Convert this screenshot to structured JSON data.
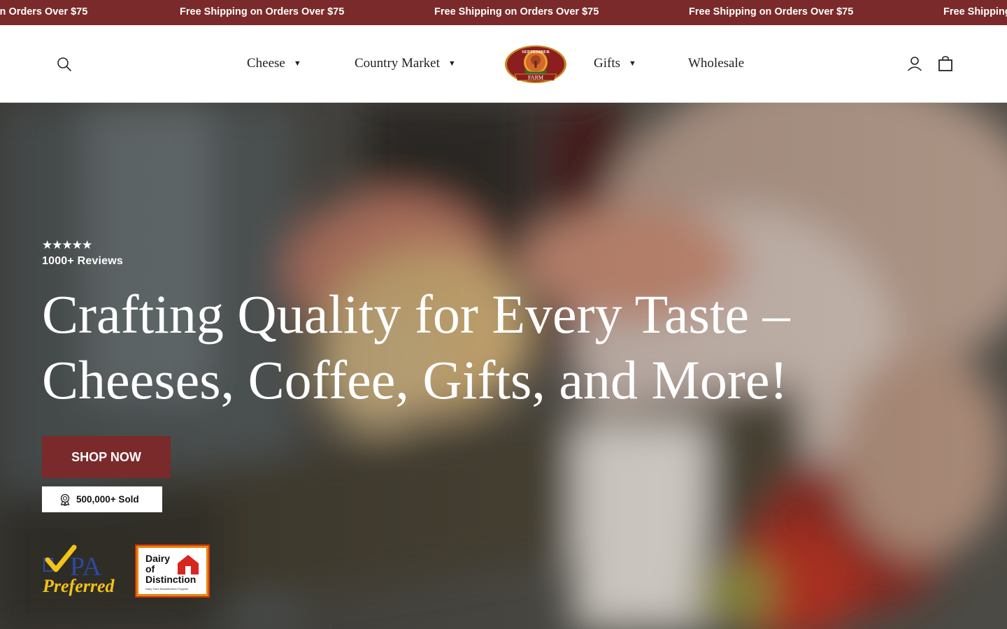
{
  "announcement": {
    "text": "Free Shipping on Orders Over $75"
  },
  "header": {
    "nav": {
      "cheese": "Cheese",
      "country_market": "Country Market",
      "gifts": "Gifts",
      "wholesale": "Wholesale"
    },
    "logo": {
      "top_text": "SEPTEMBER",
      "bottom_text": "FARM"
    },
    "icons": {
      "search": "search-icon",
      "account": "user-icon",
      "cart": "shopping-bag-icon"
    }
  },
  "hero": {
    "stars": "★★★★★",
    "reviews": "1000+ Reviews",
    "headline": "Crafting Quality for Every Taste – Cheeses, Coffee, Gifts, and More!",
    "cta": "SHOP NOW",
    "sold": "500,000+ Sold",
    "badges": {
      "pa_preferred_line1": "PA",
      "pa_preferred_line2": "Preferred",
      "dairy_line1": "Dairy",
      "dairy_line2": "of",
      "dairy_line3": "Distinction",
      "dairy_sub": "Dairy Farm Beautification Program"
    }
  },
  "colors": {
    "brand": "#7a2a2a",
    "header_bg": "#ffffff",
    "text_dark": "#222222"
  }
}
